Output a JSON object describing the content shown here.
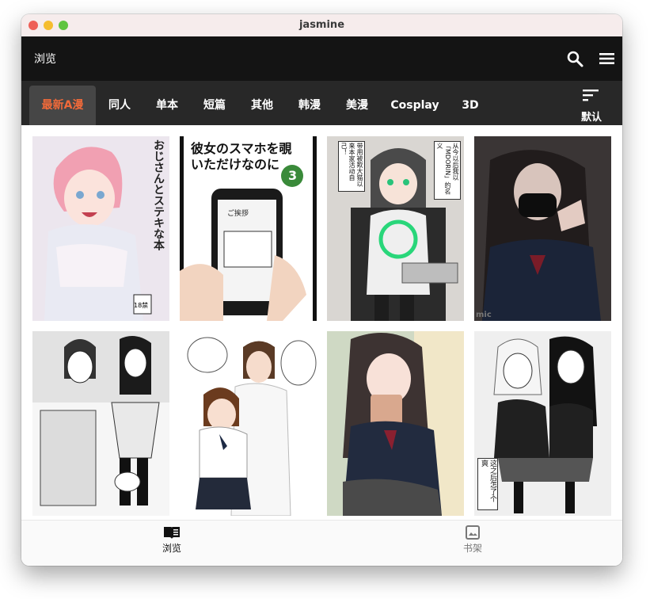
{
  "window": {
    "title": "jasmine"
  },
  "appbar": {
    "title": "浏览",
    "search_icon": "search-icon",
    "menu_icon": "menu-icon"
  },
  "tabs": [
    {
      "label": "最新A漫",
      "active": true
    },
    {
      "label": "同人"
    },
    {
      "label": "单本"
    },
    {
      "label": "短篇"
    },
    {
      "label": "其他"
    },
    {
      "label": "韩漫"
    },
    {
      "label": "美漫"
    },
    {
      "label": "Cosplay"
    },
    {
      "label": "3D"
    }
  ],
  "sort": {
    "label": "默认",
    "icon": "sort-icon"
  },
  "comics": [
    {
      "cover_text": "おじさんとステキな本",
      "badge": "18禁"
    },
    {
      "cover_text": "彼女のスマホを覗いただけなのに",
      "number": "3",
      "phone_text": "ご挨拶"
    },
    {
      "cover_text": "从今以后我以「MDORIN」的名义",
      "side_text": "带用被欺大猫以来本家活动自己！"
    },
    {
      "cover_text": "",
      "watermark": "mic"
    },
    {
      "cover_text": ""
    },
    {
      "cover_text": ""
    },
    {
      "cover_text": ""
    },
    {
      "cover_text": "这之后怎了个爽"
    }
  ],
  "bottom_nav": [
    {
      "label": "浏览",
      "icon": "book-icon",
      "active": true
    },
    {
      "label": "书架",
      "icon": "image-icon",
      "active": false
    }
  ],
  "colors": {
    "accent": "#f06a3a",
    "appbar": "#141414",
    "tabbar": "#282828"
  }
}
